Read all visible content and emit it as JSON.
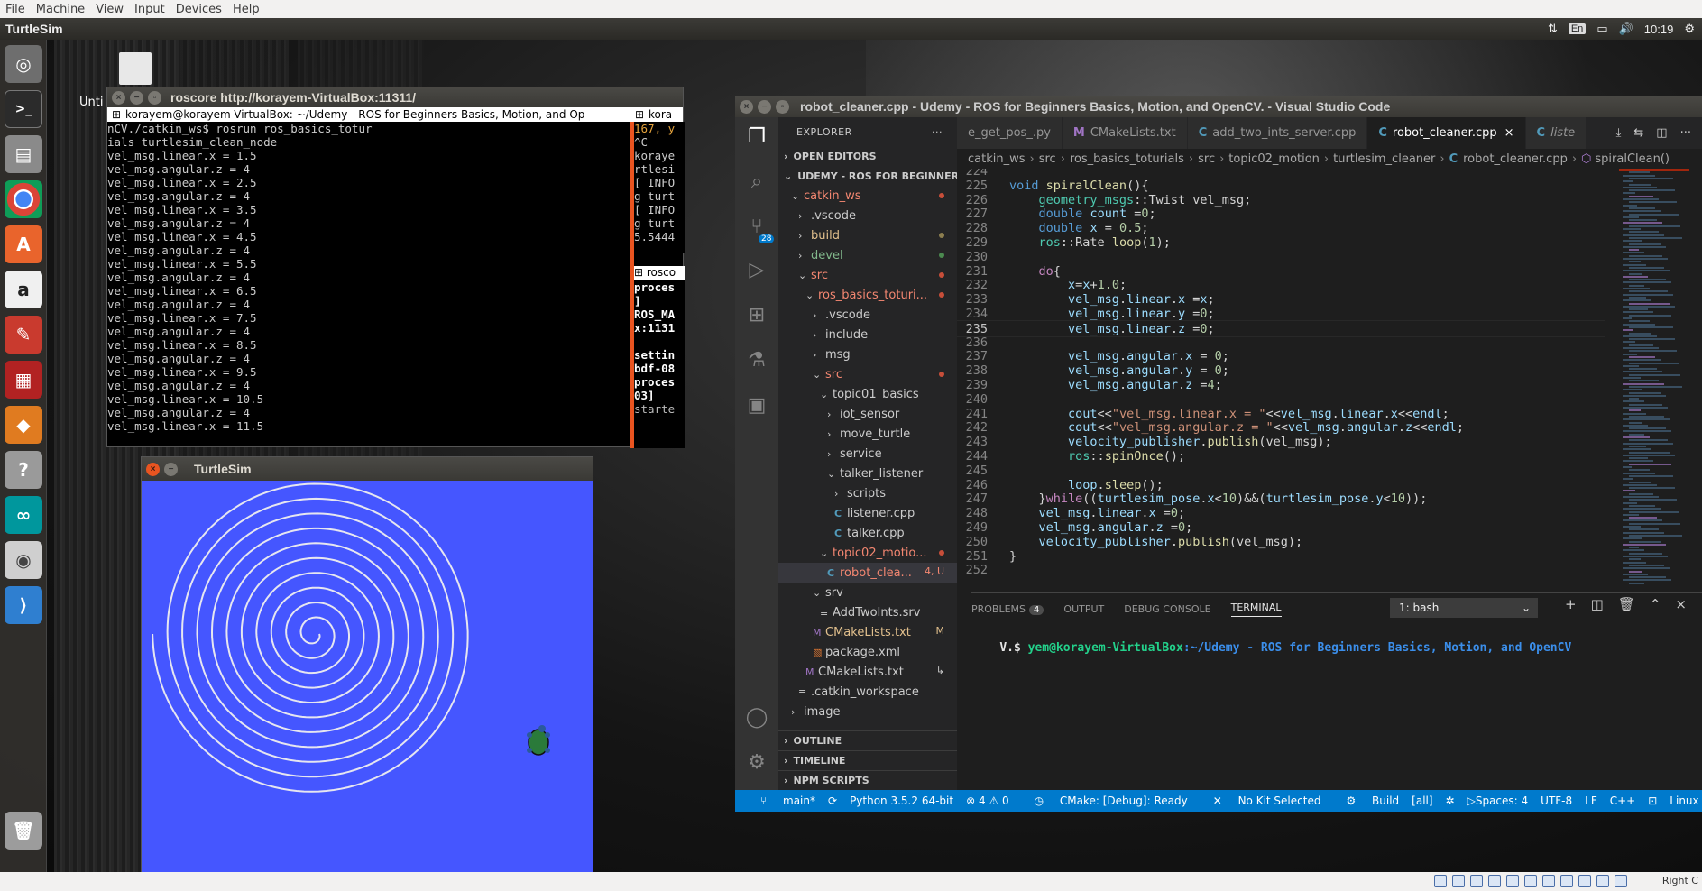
{
  "vbox_menu": [
    "File",
    "Machine",
    "View",
    "Input",
    "Devices",
    "Help"
  ],
  "top_panel": {
    "title": "TurtleSim",
    "lang": "En",
    "time": "10:19"
  },
  "desktop": {
    "label": "Unti"
  },
  "statusbar_host": {
    "right_text": "Right C"
  },
  "roscore": {
    "title": "roscore http://korayem-VirtualBox:11311/",
    "tab_left": "korayem@korayem-VirtualBox: ~/Udemy - ROS for Beginners Basics, Motion, and Op",
    "tab_right": "kora",
    "left_lines": [
      "nCV./catkin_ws$ rosrun ros_basics_totur",
      "ials turtlesim_clean_node",
      "vel_msg.linear.x = 1.5",
      "vel_msg.angular.z = 4",
      "vel_msg.linear.x = 2.5",
      "vel_msg.angular.z = 4",
      "vel_msg.linear.x = 3.5",
      "vel_msg.angular.z = 4",
      "vel_msg.linear.x = 4.5",
      "vel_msg.angular.z = 4",
      "vel_msg.linear.x = 5.5",
      "vel_msg.angular.z = 4",
      "vel_msg.linear.x = 6.5",
      "vel_msg.angular.z = 4",
      "vel_msg.linear.x = 7.5",
      "vel_msg.angular.z = 4",
      "vel_msg.linear.x = 8.5",
      "vel_msg.angular.z = 4",
      "vel_msg.linear.x = 9.5",
      "vel_msg.angular.z = 4",
      "vel_msg.linear.x = 10.5",
      "vel_msg.angular.z = 4",
      "vel_msg.linear.x = 11.5"
    ],
    "right1_lines": [
      "167, y",
      "^C",
      "koraye",
      "rtlesi",
      "[ INFO",
      "g turt",
      "[ INFO",
      "g turt",
      "5.5444"
    ],
    "right2_tab": "rosco",
    "right2_lines": [
      "proces",
      "]",
      "ROS_MA",
      "x:1131",
      "",
      "settin",
      "bdf-08",
      "proces",
      "03]",
      "starte"
    ]
  },
  "turtlesim": {
    "title": "TurtleSim",
    "background": "#4556ff"
  },
  "vscode": {
    "title": "robot_cleaner.cpp - Udemy - ROS for Beginners Basics, Motion, and OpenCV. - Visual Studio Code",
    "explorer_title": "EXPLORER",
    "open_editors": "OPEN EDITORS",
    "workspace": "UDEMY - ROS FOR BEGINNERS ...",
    "tree": [
      {
        "label": "catkin_ws",
        "indent": 1,
        "chev": "v",
        "color": "red",
        "dot": "#c74e39"
      },
      {
        "label": ".vscode",
        "indent": 2,
        "chev": ">",
        "color": "",
        "dot": ""
      },
      {
        "label": "build",
        "indent": 2,
        "chev": ">",
        "color": "yellowish",
        "dot": "#8c7e4f"
      },
      {
        "label": "devel",
        "indent": 2,
        "chev": ">",
        "color": "green",
        "dot": "#4b8a4f"
      },
      {
        "label": "src",
        "indent": 2,
        "chev": "v",
        "color": "red",
        "dot": "#c74e39"
      },
      {
        "label": "ros_basics_toturi...",
        "indent": 3,
        "chev": "v",
        "color": "red",
        "dot": "#c74e39"
      },
      {
        "label": ".vscode",
        "indent": 4,
        "chev": ">",
        "color": "",
        "dot": ""
      },
      {
        "label": "include",
        "indent": 4,
        "chev": ">",
        "color": "",
        "dot": ""
      },
      {
        "label": "msg",
        "indent": 4,
        "chev": ">",
        "color": "",
        "dot": ""
      },
      {
        "label": "src",
        "indent": 4,
        "chev": "v",
        "color": "red",
        "dot": "#c74e39"
      },
      {
        "label": "topic01_basics",
        "indent": 5,
        "chev": "v",
        "color": "",
        "dot": ""
      },
      {
        "label": "iot_sensor",
        "indent": 6,
        "chev": ">",
        "color": "",
        "dot": ""
      },
      {
        "label": "move_turtle",
        "indent": 6,
        "chev": ">",
        "color": "",
        "dot": ""
      },
      {
        "label": "service",
        "indent": 6,
        "chev": ">",
        "color": "",
        "dot": ""
      },
      {
        "label": "talker_listener",
        "indent": 6,
        "chev": "v",
        "color": "",
        "dot": ""
      },
      {
        "label": "scripts",
        "indent": 7,
        "chev": ">",
        "color": "",
        "dot": ""
      },
      {
        "label": "listener.cpp",
        "indent": 7,
        "chev": "C",
        "color": "",
        "dot": ""
      },
      {
        "label": "talker.cpp",
        "indent": 7,
        "chev": "C",
        "color": "",
        "dot": ""
      },
      {
        "label": "topic02_motio...",
        "indent": 5,
        "chev": "v",
        "color": "red",
        "dot": "#c74e39"
      },
      {
        "label": "robot_clea...",
        "indent": 6,
        "chev": "C",
        "color": "red",
        "badge": "4, U",
        "selected": true
      },
      {
        "label": "srv",
        "indent": 4,
        "chev": "v",
        "color": "",
        "dot": ""
      },
      {
        "label": "AddTwoInts.srv",
        "indent": 5,
        "chev": "=",
        "color": "",
        "dot": ""
      },
      {
        "label": "CMakeLists.txt",
        "indent": 4,
        "chev": "M",
        "color": "yellowish",
        "badge": "M"
      },
      {
        "label": "package.xml",
        "indent": 4,
        "chev": "x",
        "color": "",
        "dot": ""
      },
      {
        "label": "CMakeLists.txt",
        "indent": 3,
        "chev": "M",
        "color": "",
        "badge": "↳"
      },
      {
        "label": ".catkin_workspace",
        "indent": 2,
        "chev": "=",
        "color": "",
        "dot": ""
      },
      {
        "label": "image",
        "indent": 1,
        "chev": ">",
        "color": "",
        "dot": ""
      }
    ],
    "sections": [
      "OUTLINE",
      "TIMELINE",
      "NPM SCRIPTS"
    ],
    "tabs": [
      {
        "label": "e_get_pos_.py",
        "icon": ""
      },
      {
        "label": "CMakeLists.txt",
        "icon": "M"
      },
      {
        "label": "add_two_ints_server.cpp",
        "icon": "C"
      },
      {
        "label": "robot_cleaner.cpp",
        "icon": "C",
        "active": true
      },
      {
        "label": "liste",
        "icon": "C"
      }
    ],
    "breadcrumb": [
      "catkin_ws",
      "src",
      "ros_basics_toturials",
      "src",
      "topic02_motion",
      "turtlesim_cleaner",
      "robot_cleaner.cpp",
      "spiralClean()"
    ],
    "code": [
      {
        "n": "224",
        "html": ""
      },
      {
        "n": "225",
        "html": "<span class='k'>void</span> <span class='f'>spiralClean</span><span class='p'>(){</span>"
      },
      {
        "n": "226",
        "html": "    <span class='ty'>geometry_msgs</span><span class='p'>::Twist vel_msg;</span>"
      },
      {
        "n": "227",
        "html": "    <span class='k'>double</span> <span class='v'>count</span> <span class='p'>=</span><span class='n'>0</span><span class='p'>;</span>"
      },
      {
        "n": "228",
        "html": "    <span class='k'>double</span> <span class='v'>x</span> <span class='p'>= </span><span class='n'>0.5</span><span class='p'>;</span>"
      },
      {
        "n": "229",
        "html": "    <span class='ty'>ros</span><span class='p'>::Rate </span><span class='f'>loop</span><span class='p'>(</span><span class='n'>1</span><span class='p'>);</span>"
      },
      {
        "n": "230",
        "html": ""
      },
      {
        "n": "231",
        "html": "    <span class='c'>do</span><span class='p'>{</span>"
      },
      {
        "n": "232",
        "html": "        <span class='v'>x</span><span class='p'>=</span><span class='v'>x</span><span class='p'>+</span><span class='n'>1.0</span><span class='p'>;</span>"
      },
      {
        "n": "233",
        "html": "        <span class='v'>vel_msg</span><span class='p'>.</span><span class='v'>linear</span><span class='p'>.</span><span class='v'>x</span><span class='p'> =</span><span class='v'>x</span><span class='p'>;</span>"
      },
      {
        "n": "234",
        "html": "        <span class='v'>vel_msg</span><span class='p'>.</span><span class='v'>linear</span><span class='p'>.</span><span class='v'>y</span><span class='p'> =</span><span class='n'>0</span><span class='p'>;</span>"
      },
      {
        "n": "235",
        "html": "        <span class='v'>vel_msg</span><span class='p'>.</span><span class='v'>linear</span><span class='p'>.</span><span class='v'>z</span><span class='p'> =</span><span class='n'>0</span><span class='p'>;</span>"
      },
      {
        "n": "236",
        "html": ""
      },
      {
        "n": "237",
        "html": "        <span class='v'>vel_msg</span><span class='p'>.</span><span class='v'>angular</span><span class='p'>.</span><span class='v'>x</span><span class='p'> = </span><span class='n'>0</span><span class='p'>;</span>"
      },
      {
        "n": "238",
        "html": "        <span class='v'>vel_msg</span><span class='p'>.</span><span class='v'>angular</span><span class='p'>.</span><span class='v'>y</span><span class='p'> = </span><span class='n'>0</span><span class='p'>;</span>"
      },
      {
        "n": "239",
        "html": "        <span class='v'>vel_msg</span><span class='p'>.</span><span class='v'>angular</span><span class='p'>.</span><span class='v'>z</span><span class='p'> =</span><span class='n'>4</span><span class='p'>;</span>"
      },
      {
        "n": "240",
        "html": ""
      },
      {
        "n": "241",
        "html": "        <span class='v'>cout</span><span class='p'>&lt;&lt;</span><span class='s'>\"vel_msg.linear.x = \"</span><span class='p'>&lt;&lt;</span><span class='v'>vel_msg</span><span class='p'>.</span><span class='v'>linear</span><span class='p'>.</span><span class='v'>x</span><span class='p'>&lt;&lt;</span><span class='v'>endl</span><span class='p'>;</span>"
      },
      {
        "n": "242",
        "html": "        <span class='v'>cout</span><span class='p'>&lt;&lt;</span><span class='s'>\"vel_msg.angular.z = \"</span><span class='p'>&lt;&lt;</span><span class='v'>vel_msg</span><span class='p'>.</span><span class='v'>angular</span><span class='p'>.</span><span class='v'>z</span><span class='p'>&lt;&lt;</span><span class='v'>endl</span><span class='p'>;</span>"
      },
      {
        "n": "243",
        "html": "        <span class='v'>velocity_publisher</span><span class='p'>.</span><span class='f'>publish</span><span class='p'>(vel_msg);</span>"
      },
      {
        "n": "244",
        "html": "        <span class='ty'>ros</span><span class='p'>::</span><span class='f'>spinOnce</span><span class='p'>();</span>"
      },
      {
        "n": "245",
        "html": ""
      },
      {
        "n": "246",
        "html": "        <span class='v'>loop</span><span class='p'>.</span><span class='f'>sleep</span><span class='p'>();</span>"
      },
      {
        "n": "247",
        "html": "    <span class='p'>}</span><span class='c'>while</span><span class='p'>((</span><span class='v'>turtlesim_pose</span><span class='p'>.</span><span class='v'>x</span><span class='p'>&lt;</span><span class='n'>10</span><span class='p'>)&amp;&amp;(</span><span class='v'>turtlesim_pose</span><span class='p'>.</span><span class='v'>y</span><span class='p'>&lt;</span><span class='n'>10</span><span class='p'>));</span>"
      },
      {
        "n": "248",
        "html": "    <span class='v'>vel_msg</span><span class='p'>.</span><span class='v'>linear</span><span class='p'>.</span><span class='v'>x</span><span class='p'> =</span><span class='n'>0</span><span class='p'>;</span>"
      },
      {
        "n": "249",
        "html": "    <span class='v'>vel_msg</span><span class='p'>.</span><span class='v'>angular</span><span class='p'>.</span><span class='v'>z</span><span class='p'> =</span><span class='n'>0</span><span class='p'>;</span>"
      },
      {
        "n": "250",
        "html": "    <span class='v'>velocity_publisher</span><span class='p'>.</span><span class='f'>publish</span><span class='p'>(vel_msg);</span>"
      },
      {
        "n": "251",
        "html": "<span class='p'>}</span>"
      },
      {
        "n": "252",
        "html": ""
      }
    ],
    "current_line": "235",
    "panel_tabs": {
      "problems": "PROBLEMS",
      "problems_count": "4",
      "output": "OUTPUT",
      "debug": "DEBUG CONSOLE",
      "terminal": "TERMINAL"
    },
    "terminal_select": "1: bash",
    "terminal_prompt_prefix": "V.$ ",
    "terminal_user": "yem@korayem-VirtualBox",
    "terminal_path": ":~/Udemy - ROS for Beginners Basics, Motion, and OpenCV",
    "status": {
      "branch": "main*",
      "python": "Python 3.5.2 64-bit",
      "problems": "⊗ 4 ⚠ 0",
      "cmake": "CMake: [Debug]: Ready",
      "kit": "No Kit Selected",
      "build": "Build",
      "all": "[all]",
      "spaces": "Spaces: 4",
      "encoding": "UTF-8",
      "eol": "LF",
      "lang": "C++",
      "os": "Linux"
    }
  }
}
